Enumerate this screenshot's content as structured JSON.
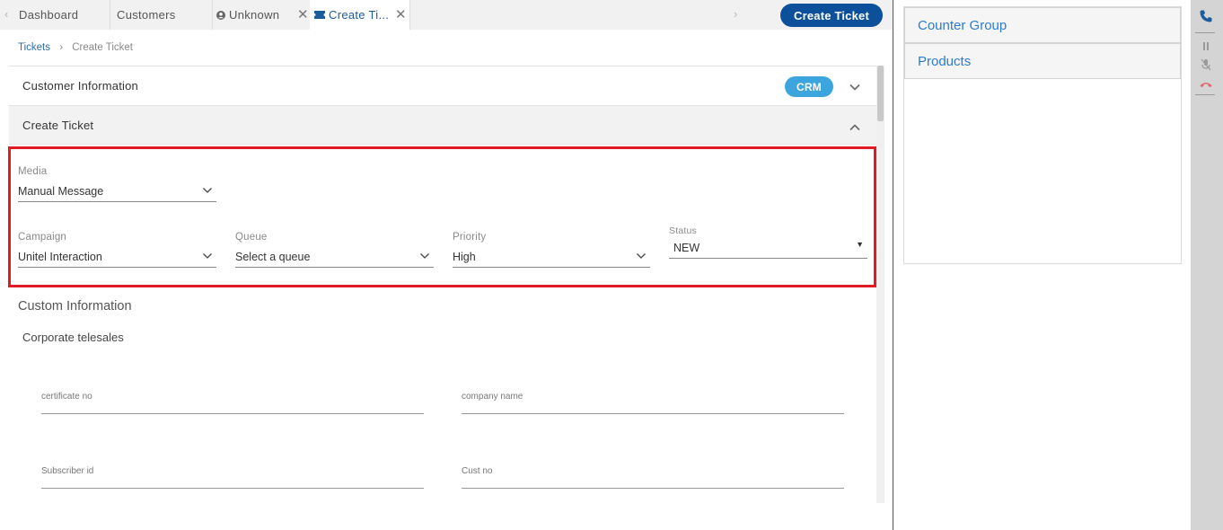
{
  "tabs": [
    {
      "label": "Dashboard"
    },
    {
      "label": "Customers"
    },
    {
      "label": "Unknown"
    },
    {
      "label": "Create Ti..."
    }
  ],
  "header": {
    "create_ticket_label": "Create Ticket"
  },
  "breadcrumb": {
    "root": "Tickets",
    "current": "Create Ticket"
  },
  "panels": {
    "customer_info": "Customer Information",
    "crm_badge": "CRM",
    "create_ticket": "Create Ticket"
  },
  "form": {
    "media": {
      "label": "Media",
      "value": "Manual Message"
    },
    "campaign": {
      "label": "Campaign",
      "value": "Unitel Interaction"
    },
    "queue": {
      "label": "Queue",
      "value": "Select a queue"
    },
    "priority": {
      "label": "Priority",
      "value": "High"
    },
    "status": {
      "label": "Status",
      "value": "NEW"
    }
  },
  "custom": {
    "title": "Custom Information",
    "group": "Corporate telesales",
    "fields": {
      "certificate_no": "certificate no",
      "company_name": "company name",
      "subscriber_id": "Subscriber id",
      "cust_no": "Cust no"
    }
  },
  "side": {
    "items": [
      "Counter Group",
      "Products"
    ]
  },
  "colors": {
    "brand": "#0c4f9a",
    "accent": "#3da5de",
    "highlight": "#e01b24",
    "link": "#2b7cd3"
  }
}
